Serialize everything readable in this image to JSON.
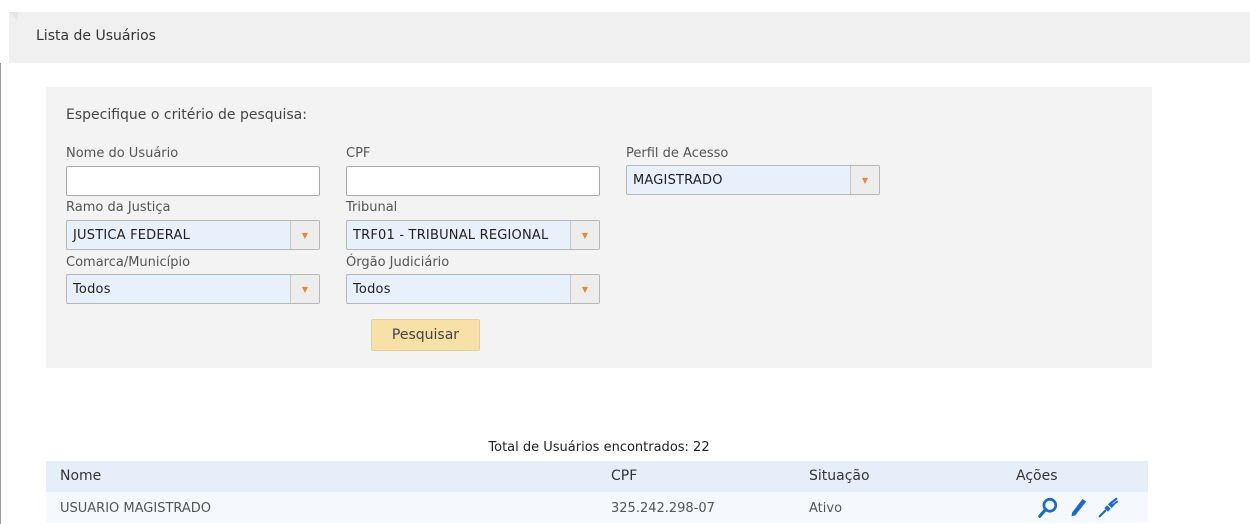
{
  "page": {
    "title": "Lista de Usuários"
  },
  "search": {
    "criteria_label": "Especifique o critério de pesquisa:",
    "fields": {
      "nome": {
        "label": "Nome do Usuário",
        "value": ""
      },
      "cpf": {
        "label": "CPF",
        "value": ""
      },
      "perfil": {
        "label": "Perfil de Acesso",
        "value": "MAGISTRADO"
      },
      "ramo": {
        "label": "Ramo da Justiça",
        "value": "JUSTICA FEDERAL"
      },
      "tribunal": {
        "label": "Tribunal",
        "value": "TRF01 - TRIBUNAL REGIONAL"
      },
      "comarca": {
        "label": "Comarca/Município",
        "value": "Todos"
      },
      "orgao": {
        "label": "Órgão Judiciário",
        "value": "Todos"
      }
    },
    "button_label": "Pesquisar"
  },
  "results": {
    "total_text": "Total de Usuários encontrados: 22",
    "columns": [
      "Nome",
      "CPF",
      "Situação",
      "Ações"
    ],
    "rows": [
      {
        "nome": "USUARIO MAGISTRADO",
        "cpf": "325.242.298-07",
        "situacao": "Ativo"
      }
    ]
  },
  "icons": {
    "view": "search-icon",
    "edit": "pencil-icon",
    "deactivate": "unplug-icon"
  },
  "colors": {
    "accent": "#1a6cc4",
    "arrow": "#e08a3c",
    "button": "#f7e1a9",
    "select_bg": "#e8f0fb"
  }
}
